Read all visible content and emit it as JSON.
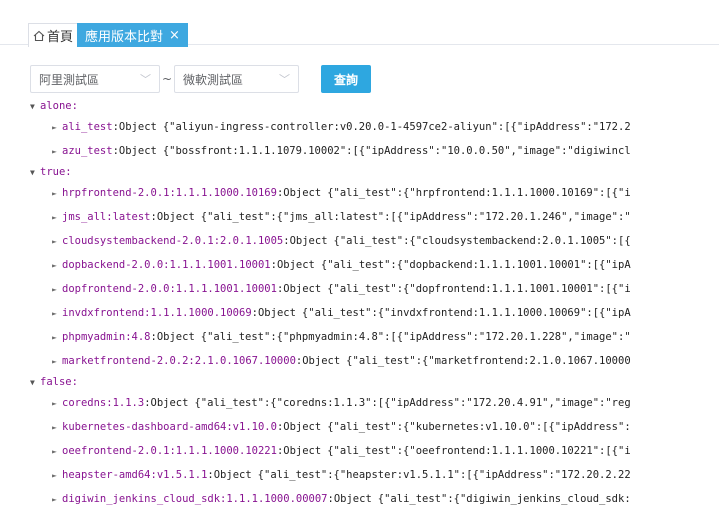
{
  "tabs": {
    "home_label": "首頁",
    "active_label": "應用版本比對",
    "close_symbol": "×"
  },
  "filters": {
    "source_env": "阿里測試區",
    "separator": "~",
    "target_env": "微軟測試區",
    "query_label": "查詢"
  },
  "colors": {
    "accent": "#2ea7e0",
    "key": "#881391",
    "text": "#222222"
  },
  "tree": {
    "groups": [
      {
        "label": "alone:",
        "items": [
          {
            "key": "ali_test",
            "type": "Object",
            "value": "{\"aliyun-ingress-controller:v0.20.0-1-4597ce2-aliyun\":[{\"ipAddress\":\"172.2"
          },
          {
            "key": "azu_test",
            "type": "Object",
            "value": "{\"bossfront:1.1.1.1079.10002\":[{\"ipAddress\":\"10.0.0.50\",\"image\":\"digiwincl"
          }
        ]
      },
      {
        "label": "true:",
        "items": [
          {
            "key": "hrpfrontend-2.0.1:1.1.1.1000.10169",
            "type": "Object",
            "value": "{\"ali_test\":{\"hrpfrontend:1.1.1.1000.10169\":[{\"i"
          },
          {
            "key": "jms_all:latest",
            "type": "Object",
            "value": "{\"ali_test\":{\"jms_all:latest\":[{\"ipAddress\":\"172.20.1.246\",\"image\":\""
          },
          {
            "key": "cloudsystembackend-2.0.1:2.0.1.1005",
            "type": "Object",
            "value": "{\"ali_test\":{\"cloudsystembackend:2.0.1.1005\":[{"
          },
          {
            "key": "dopbackend-2.0.0:1.1.1.1001.10001",
            "type": "Object",
            "value": "{\"ali_test\":{\"dopbackend:1.1.1.1001.10001\":[{\"ipA"
          },
          {
            "key": "dopfrontend-2.0.0:1.1.1.1001.10001",
            "type": "Object",
            "value": "{\"ali_test\":{\"dopfrontend:1.1.1.1001.10001\":[{\"i"
          },
          {
            "key": "invdxfrontend:1.1.1.1000.10069",
            "type": "Object",
            "value": "{\"ali_test\":{\"invdxfrontend:1.1.1.1000.10069\":[{\"ipA"
          },
          {
            "key": "phpmyadmin:4.8",
            "type": "Object",
            "value": "{\"ali_test\":{\"phpmyadmin:4.8\":[{\"ipAddress\":\"172.20.1.228\",\"image\":\""
          },
          {
            "key": "marketfrontend-2.0.2:2.1.0.1067.10000",
            "type": "Object",
            "value": "{\"ali_test\":{\"marketfrontend:2.1.0.1067.10000"
          }
        ]
      },
      {
        "label": "false:",
        "items": [
          {
            "key": "coredns:1.1.3",
            "type": "Object",
            "value": "{\"ali_test\":{\"coredns:1.1.3\":[{\"ipAddress\":\"172.20.4.91\",\"image\":\"reg"
          },
          {
            "key": "kubernetes-dashboard-amd64:v1.10.0",
            "type": "Object",
            "value": "{\"ali_test\":{\"kubernetes:v1.10.0\":[{\"ipAddress\":"
          },
          {
            "key": "oeefrontend-2.0.1:1.1.1.1000.10221",
            "type": "Object",
            "value": "{\"ali_test\":{\"oeefrontend:1.1.1.1000.10221\":[{\"i"
          },
          {
            "key": "heapster-amd64:v1.5.1.1",
            "type": "Object",
            "value": "{\"ali_test\":{\"heapster:v1.5.1.1\":[{\"ipAddress\":\"172.20.2.22"
          },
          {
            "key": "digiwin_jenkins_cloud_sdk:1.1.1.1000.00007",
            "type": "Object",
            "value": "{\"ali_test\":{\"digiwin_jenkins_cloud_sdk:"
          }
        ]
      }
    ]
  }
}
